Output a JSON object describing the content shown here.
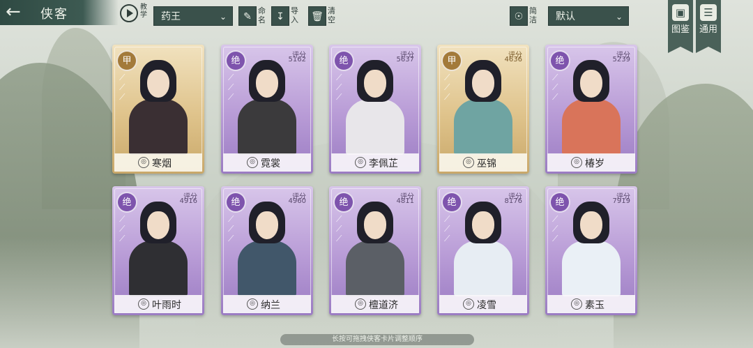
{
  "header": {
    "title": "侠客",
    "tutorial_label": "教学",
    "group_select": "药王",
    "rename_label": "命名",
    "import_label": "导入",
    "clear_label": "清空",
    "simple_label": "简洁",
    "sort_select": "默认",
    "gallery_label": "图鉴",
    "general_label": "通用"
  },
  "score_label": "评分",
  "cards": [
    {
      "name": "寒烟",
      "rank": "甲",
      "score": "",
      "tier": "gold",
      "outfit": "#3a2f33"
    },
    {
      "name": "霓裳",
      "rank": "绝",
      "score": "5162",
      "tier": "purple",
      "outfit": "#3b3a3c"
    },
    {
      "name": "李佩芷",
      "rank": "绝",
      "score": "5637",
      "tier": "purple",
      "outfit": "#e8e6ea"
    },
    {
      "name": "巫锦",
      "rank": "甲",
      "score": "4636",
      "tier": "gold",
      "outfit": "#6fa4a2"
    },
    {
      "name": "椿岁",
      "rank": "绝",
      "score": "5239",
      "tier": "purple",
      "outfit": "#d9745a"
    },
    {
      "name": "叶雨时",
      "rank": "绝",
      "score": "4916",
      "tier": "purple",
      "outfit": "#2f2f33"
    },
    {
      "name": "纳兰",
      "rank": "绝",
      "score": "4960",
      "tier": "purple",
      "outfit": "#41576a"
    },
    {
      "name": "檀道济",
      "rank": "绝",
      "score": "4811",
      "tier": "purple",
      "outfit": "#5b5f66"
    },
    {
      "name": "凌雪",
      "rank": "绝",
      "score": "8176",
      "tier": "purple",
      "outfit": "#e7edf3"
    },
    {
      "name": "素玉",
      "rank": "绝",
      "score": "7919",
      "tier": "purple",
      "outfit": "#eaf0f6"
    }
  ],
  "footer_hint": "长按可拖拽侠客卡片调整顺序"
}
